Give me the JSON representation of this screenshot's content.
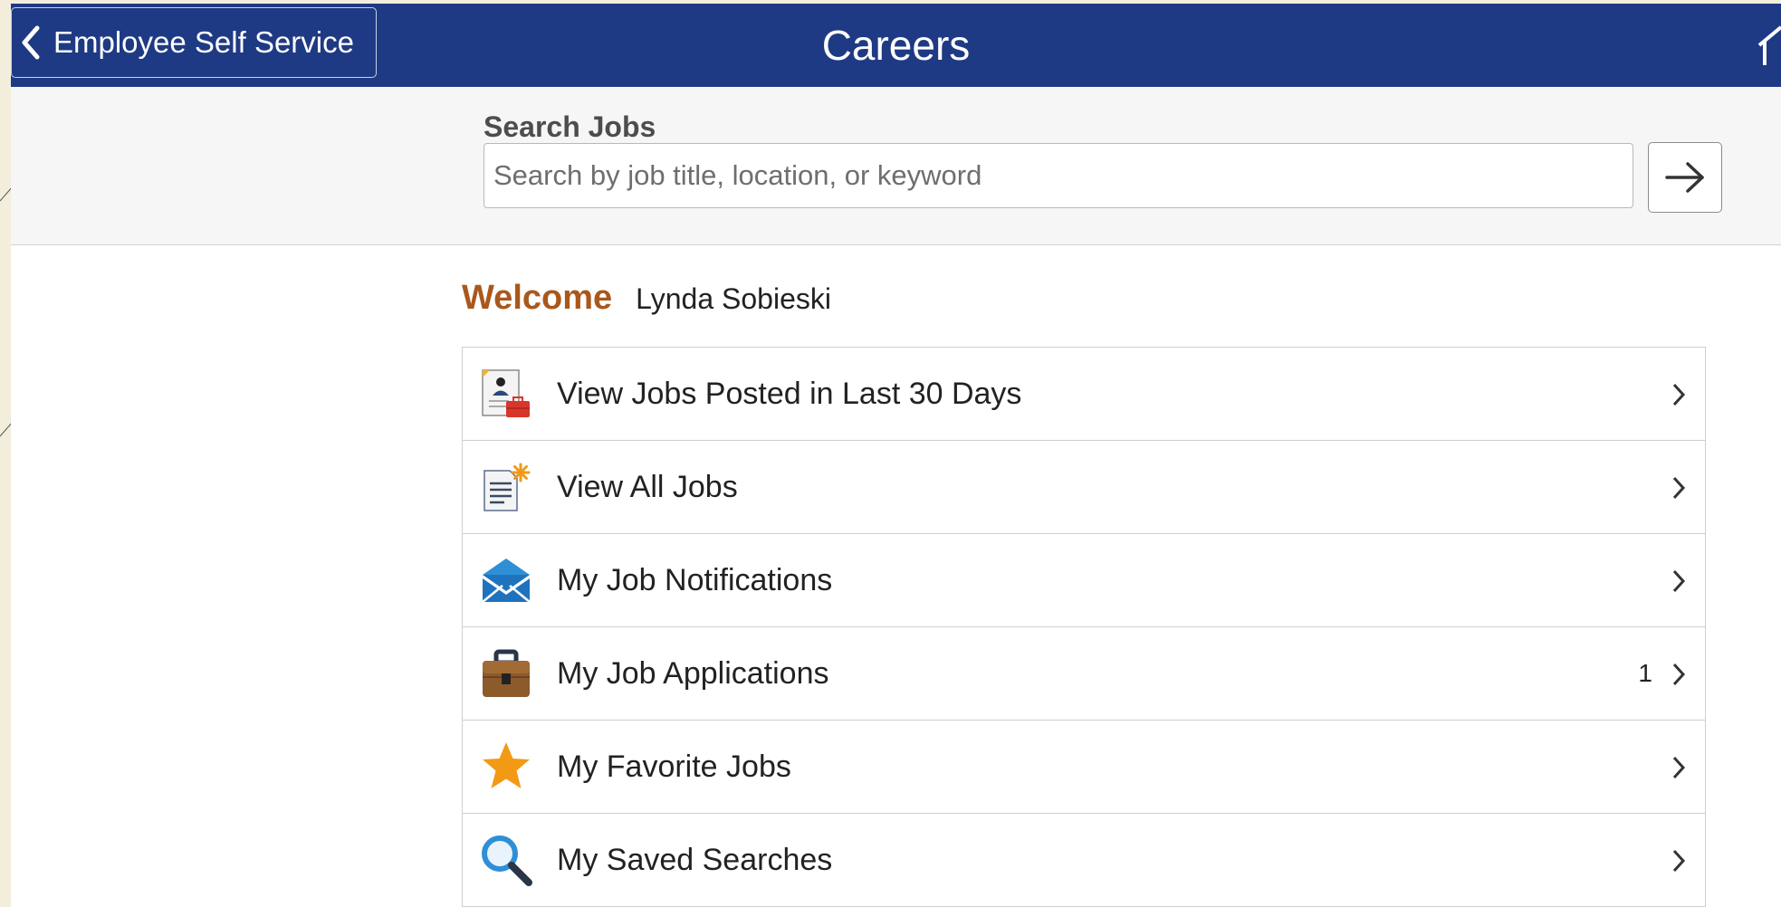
{
  "header": {
    "back_label": "Employee Self Service",
    "title": "Careers",
    "bg_color": "#1f3a84"
  },
  "search": {
    "label": "Search Jobs",
    "placeholder": "Search by job title, location, or keyword",
    "value": ""
  },
  "welcome": {
    "greeting": "Welcome",
    "user_name": "Lynda Sobieski"
  },
  "menu": {
    "items": [
      {
        "label": "View Jobs Posted in Last 30 Days",
        "icon": "job-posting-icon",
        "count": ""
      },
      {
        "label": "View All Jobs",
        "icon": "job-list-icon",
        "count": ""
      },
      {
        "label": "My Job Notifications",
        "icon": "envelope-icon",
        "count": ""
      },
      {
        "label": "My Job Applications",
        "icon": "briefcase-icon",
        "count": "1"
      },
      {
        "label": "My Favorite Jobs",
        "icon": "star-icon",
        "count": ""
      },
      {
        "label": "My Saved Searches",
        "icon": "magnifier-icon",
        "count": ""
      }
    ]
  }
}
